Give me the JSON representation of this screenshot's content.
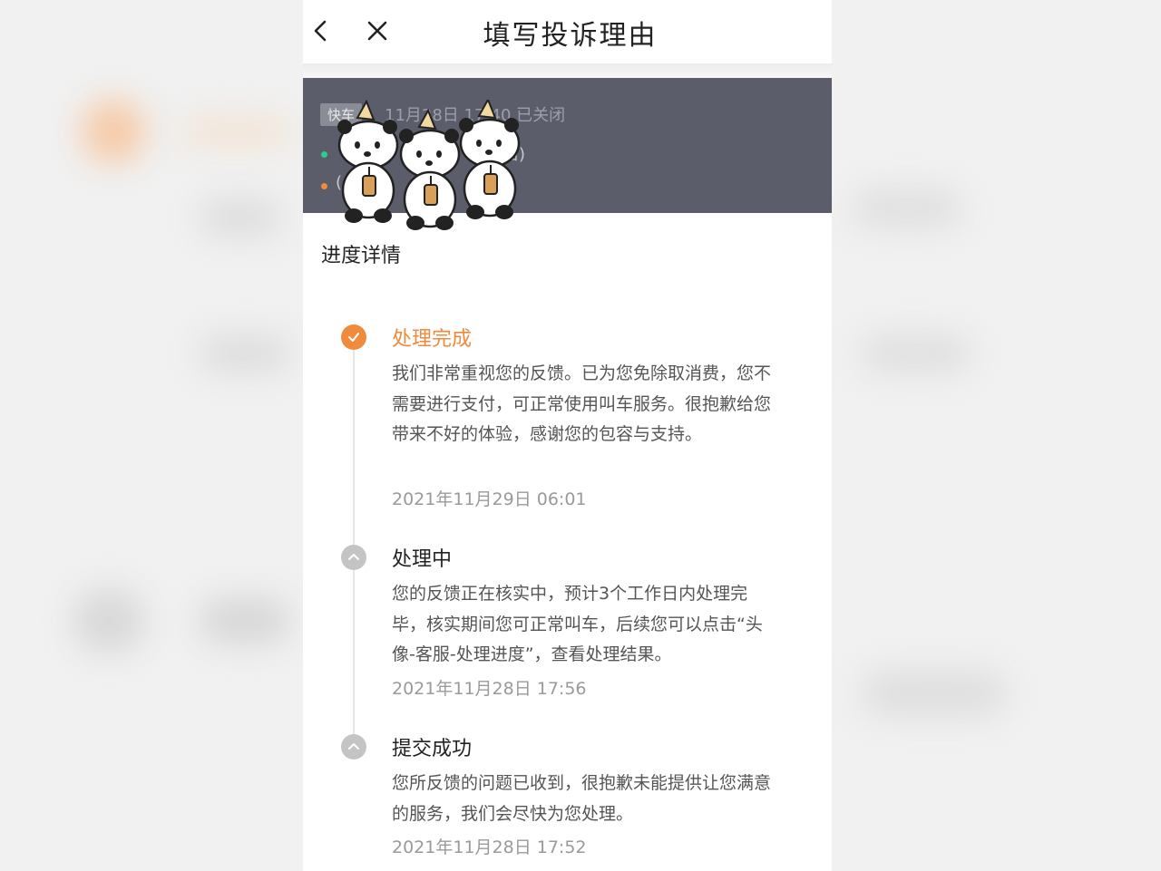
{
  "nav": {
    "title": "填写投诉理由"
  },
  "order_card": {
    "tag": "快车",
    "time_status": "11月28日 17:40  已关闭",
    "start_fragment": "店)",
    "end_fragment": "(",
    "start_dot_color": "#2ecc8f",
    "end_dot_color": "#f08a3c"
  },
  "progress": {
    "title": "进度详情",
    "steps": [
      {
        "title": "处理完成",
        "description": "我们非常重视您的反馈。已为您免除取消费，您不需要进行支付，可正常使用叫车服务。很抱歉给您带来不好的体验，感谢您的包容与支持。",
        "date": "2021年11月29日 06:01",
        "state": "completed",
        "icon": "check-icon"
      },
      {
        "title": "处理中",
        "description": "您的反馈正在核实中，预计3个工作日内处理完毕，核实期间您可正常叫车，后续您可以点击“头像-客服-处理进度”，查看处理结果。",
        "date": "2021年11月28日 17:56",
        "state": "past",
        "icon": "chevron-up-icon"
      },
      {
        "title": "提交成功",
        "description": "您所反馈的问题已收到，很抱歉未能提供让您满意的服务，我们会尽快为您处理。",
        "date": "2021年11月28日 17:52",
        "state": "past",
        "icon": "chevron-up-icon"
      }
    ]
  },
  "colors": {
    "accent": "#f08a3c",
    "card_bg": "#5b5d6b",
    "muted_icon": "#c4c4c4"
  }
}
